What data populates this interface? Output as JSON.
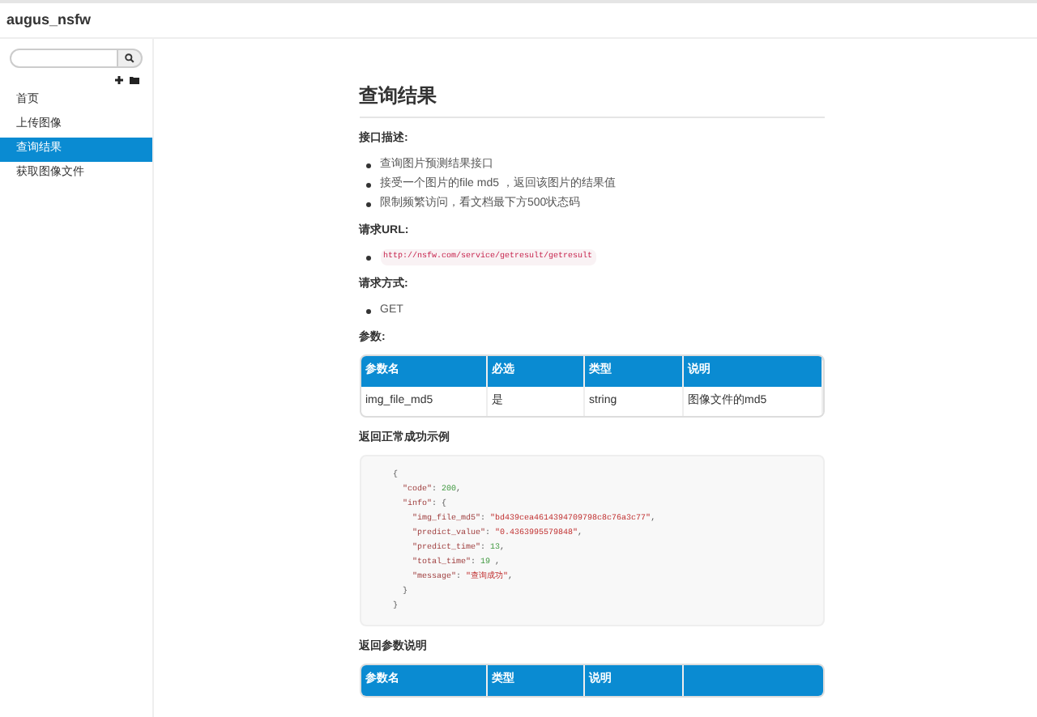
{
  "header": {
    "title": "augus_nsfw"
  },
  "sidebar": {
    "items": [
      {
        "label": "首页",
        "selected": false
      },
      {
        "label": "上传图像",
        "selected": false
      },
      {
        "label": "查询结果",
        "selected": true
      },
      {
        "label": "获取图像文件",
        "selected": false
      }
    ]
  },
  "content": {
    "title": "查询结果",
    "sections": [
      {
        "kind": "list",
        "heading": "接口描述:",
        "items": [
          "查询图片预测结果接口",
          "接受一个图片的file md5 ，返回该图片的结果值",
          "限制频繁访问，看文档最下方500状态码"
        ]
      },
      {
        "kind": "code_list",
        "heading": "请求URL:",
        "items": [
          "http://nsfw.com/service/getresult/getresult"
        ]
      },
      {
        "kind": "list",
        "heading": "请求方式:",
        "items": [
          "GET"
        ]
      },
      {
        "kind": "table",
        "heading": "参数:",
        "columns": [
          "参数名",
          "必选",
          "类型",
          "说明"
        ],
        "rows": [
          [
            "img_file_md5",
            "是",
            "string",
            "图像文件的md5"
          ]
        ]
      },
      {
        "kind": "code",
        "heading": "返回正常成功示例",
        "lines": [
          [
            {
              "t": "{",
              "kind": "punct"
            }
          ],
          [
            {
              "t": "  \"code\"",
              "kind": "key"
            },
            {
              "t": ": ",
              "kind": "punct"
            },
            {
              "t": "200",
              "kind": "number"
            },
            {
              "t": ",",
              "kind": "punct"
            }
          ],
          [
            {
              "t": "  \"info\"",
              "kind": "key"
            },
            {
              "t": ": {",
              "kind": "punct"
            }
          ],
          [
            {
              "t": "    \"img_file_md5\"",
              "kind": "key"
            },
            {
              "t": ": ",
              "kind": "punct"
            },
            {
              "t": "\"bd439cea4614394709798c8c76a3c77\"",
              "kind": "string"
            },
            {
              "t": ",",
              "kind": "punct"
            }
          ],
          [
            {
              "t": "    \"predict_value\"",
              "kind": "key"
            },
            {
              "t": ": ",
              "kind": "punct"
            },
            {
              "t": "\"0.4363995579848\"",
              "kind": "string"
            },
            {
              "t": ",",
              "kind": "punct"
            }
          ],
          [
            {
              "t": "    \"predict_time\"",
              "kind": "key"
            },
            {
              "t": ": ",
              "kind": "punct"
            },
            {
              "t": "13",
              "kind": "number"
            },
            {
              "t": ",",
              "kind": "punct"
            }
          ],
          [
            {
              "t": "    \"total_time\"",
              "kind": "key"
            },
            {
              "t": ": ",
              "kind": "punct"
            },
            {
              "t": "19",
              "kind": "number"
            },
            {
              "t": " ,",
              "kind": "punct"
            }
          ],
          [
            {
              "t": "    \"message\"",
              "kind": "key"
            },
            {
              "t": ": ",
              "kind": "punct"
            },
            {
              "t": "\"查询成功\"",
              "kind": "string"
            },
            {
              "t": ",",
              "kind": "punct"
            }
          ],
          [
            {
              "t": "  }",
              "kind": "punct"
            }
          ],
          [
            {
              "t": "}",
              "kind": "punct"
            }
          ]
        ]
      },
      {
        "kind": "table",
        "heading": "返回参数说明",
        "columns": [
          "参数名",
          "类型",
          "说明"
        ]
      }
    ]
  }
}
